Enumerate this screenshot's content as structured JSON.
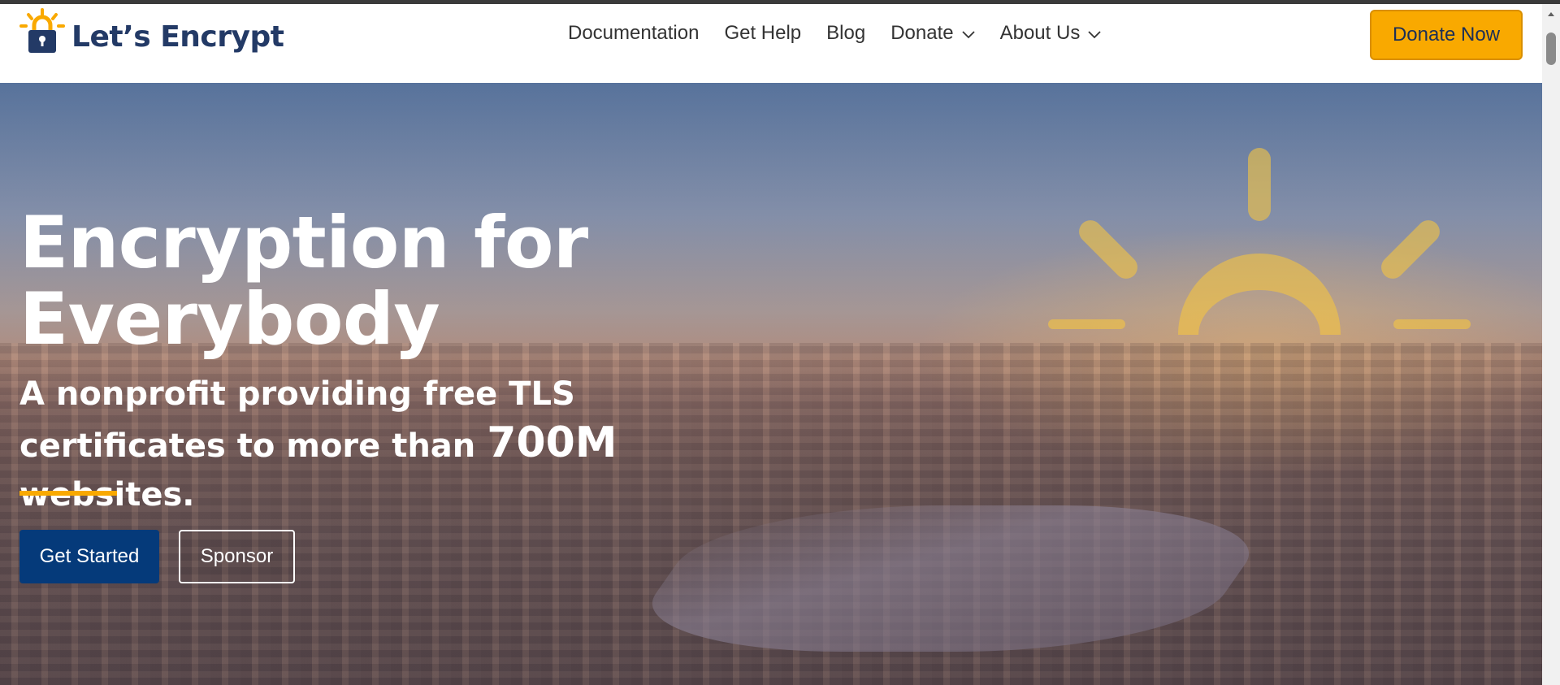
{
  "brand": {
    "name": "Let’s Encrypt",
    "logo_icon": "padlock-sun-icon",
    "text_color": "#233a66",
    "accent_color": "#f9a900"
  },
  "nav": {
    "items": [
      {
        "label": "Documentation",
        "has_dropdown": false
      },
      {
        "label": "Get Help",
        "has_dropdown": false
      },
      {
        "label": "Blog",
        "has_dropdown": false
      },
      {
        "label": "Donate",
        "has_dropdown": true
      },
      {
        "label": "About Us",
        "has_dropdown": true
      }
    ],
    "cta_label": "Donate Now"
  },
  "hero": {
    "title_line1": "Encryption for",
    "title_line2": "Everybody",
    "subtitle_line1": "A nonprofit providing free TLS",
    "subtitle_line2_pre": "certificates to more than ",
    "subtitle_count": "700M",
    "subtitle_line2_post": " websites.",
    "primary_button": "Get Started",
    "secondary_button": "Sponsor",
    "primary_color": "#053a7a"
  }
}
